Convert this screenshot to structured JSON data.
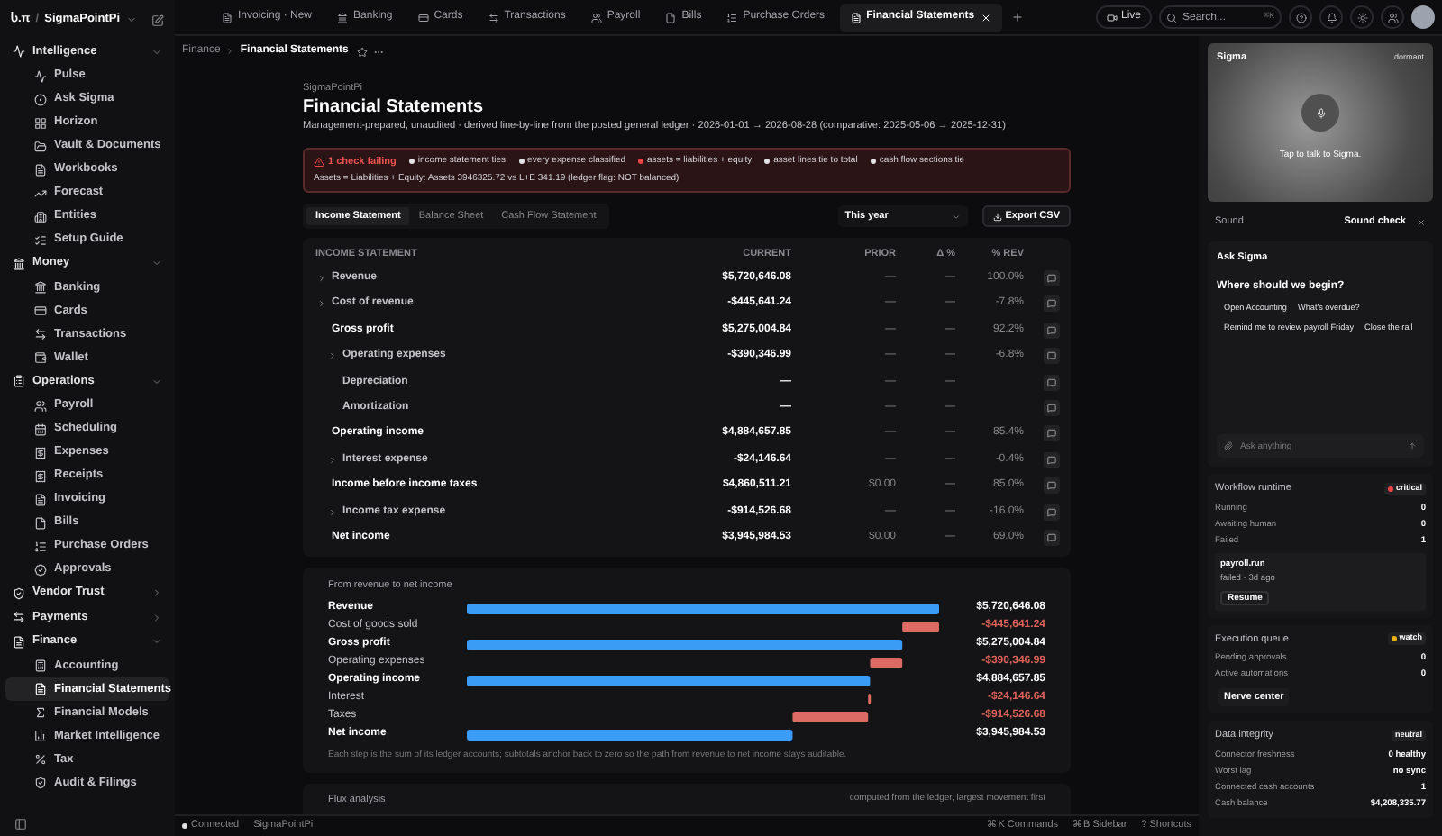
{
  "workspace": {
    "logo": "Ⴑ.π",
    "separator": "/",
    "name": "SigmaPointPi"
  },
  "sidebar": {
    "groups": [
      {
        "label": "Intelligence",
        "expanded": true,
        "items": [
          {
            "label": "Pulse",
            "selected": false
          },
          {
            "label": "Ask Sigma",
            "selected": false
          },
          {
            "label": "Horizon",
            "selected": false
          },
          {
            "label": "Vault & Documents",
            "selected": false
          },
          {
            "label": "Workbooks",
            "selected": false
          },
          {
            "label": "Forecast",
            "selected": false
          },
          {
            "label": "Entities",
            "selected": false
          },
          {
            "label": "Setup Guide",
            "selected": false
          }
        ]
      },
      {
        "label": "Money",
        "expanded": true,
        "items": [
          {
            "label": "Banking",
            "selected": false
          },
          {
            "label": "Cards",
            "selected": false
          },
          {
            "label": "Transactions",
            "selected": false
          },
          {
            "label": "Wallet",
            "selected": false
          }
        ]
      },
      {
        "label": "Operations",
        "expanded": true,
        "items": [
          {
            "label": "Payroll",
            "selected": false
          },
          {
            "label": "Scheduling",
            "selected": false
          },
          {
            "label": "Expenses",
            "selected": false
          },
          {
            "label": "Receipts",
            "selected": false
          },
          {
            "label": "Invoicing",
            "selected": false
          },
          {
            "label": "Bills",
            "selected": false
          },
          {
            "label": "Purchase Orders",
            "selected": false
          },
          {
            "label": "Approvals",
            "selected": false
          }
        ]
      },
      {
        "label": "Vendor Trust",
        "expanded": false
      },
      {
        "label": "Payments",
        "expanded": false
      },
      {
        "label": "Finance",
        "expanded": true,
        "items": [
          {
            "label": "Accounting",
            "selected": false
          },
          {
            "label": "Financial Statements",
            "selected": true
          },
          {
            "label": "Financial Models",
            "selected": false
          },
          {
            "label": "Market Intelligence",
            "selected": false
          },
          {
            "label": "Tax",
            "selected": false
          },
          {
            "label": "Audit & Filings",
            "selected": false
          }
        ]
      }
    ]
  },
  "tabs": [
    {
      "label": "Invoicing · New",
      "selected": false
    },
    {
      "label": "Banking",
      "selected": false
    },
    {
      "label": "Cards",
      "selected": false
    },
    {
      "label": "Transactions",
      "selected": false
    },
    {
      "label": "Payroll",
      "selected": false
    },
    {
      "label": "Bills",
      "selected": false
    },
    {
      "label": "Purchase Orders",
      "selected": false
    },
    {
      "label": "Financial Statements",
      "selected": true
    }
  ],
  "toolbar": {
    "live": "Live",
    "search": {
      "placeholder": "Search...",
      "shortcut": "⌘K"
    }
  },
  "breadcrumb": [
    "Finance",
    "Financial Statements"
  ],
  "header": {
    "company": "SigmaPointPi",
    "title": "Financial Statements",
    "subtitle": "Management-prepared, unaudited · derived line-by-line from the posted general ledger · 2026-01-01 → 2026-08-28 (comparative: 2025-05-06 → 2025-12-31)"
  },
  "checks": {
    "summary": "1 check failing",
    "items": [
      {
        "label": "income statement ties",
        "ok": true
      },
      {
        "label": "every expense classified",
        "ok": true
      },
      {
        "label": "assets = liabilities + equity",
        "ok": false
      },
      {
        "label": "asset lines tie to total",
        "ok": true
      },
      {
        "label": "cash flow sections tie",
        "ok": true
      }
    ],
    "detail": "Assets = Liabilities + Equity: Assets 3946325.72 vs L+E 341.19 (ledger flag: NOT balanced)"
  },
  "statement_tabs": [
    {
      "label": "Income Statement",
      "selected": true
    },
    {
      "label": "Balance Sheet",
      "selected": false
    },
    {
      "label": "Cash Flow Statement",
      "selected": false
    }
  ],
  "period": {
    "value": "This year"
  },
  "export": "Export CSV",
  "table": {
    "columns": [
      "INCOME STATEMENT",
      "CURRENT",
      "PRIOR",
      "Δ %",
      "% REV"
    ],
    "rows": [
      {
        "kind": "account",
        "expanded": false,
        "label": "Revenue",
        "current": "$5,720,646.08",
        "prior": "—",
        "delta": "—",
        "rev": "100.0%"
      },
      {
        "kind": "account",
        "expanded": false,
        "label": "Cost of revenue",
        "current": "-$445,641.24",
        "prior": "—",
        "delta": "—",
        "rev": "-7.8%"
      },
      {
        "kind": "subtotal",
        "label": "Gross profit",
        "current": "$5,275,004.84",
        "prior": "—",
        "delta": "—",
        "rev": "92.2%"
      },
      {
        "kind": "expense",
        "expanded": false,
        "label": "Operating expenses",
        "current": "-$390,346.99",
        "prior": "—",
        "delta": "—",
        "rev": "-6.8%"
      },
      {
        "kind": "detail",
        "label": "Depreciation",
        "current": "—",
        "prior": "—",
        "delta": "—"
      },
      {
        "kind": "detail",
        "label": "Amortization",
        "current": "—",
        "prior": "—",
        "delta": "—"
      },
      {
        "kind": "subtotal",
        "label": "Operating income",
        "current": "$4,884,657.85",
        "prior": "—",
        "delta": "—",
        "rev": "85.4%"
      },
      {
        "kind": "expense",
        "expanded": false,
        "label": "Interest expense",
        "current": "-$24,146.64",
        "prior": "—",
        "delta": "—",
        "rev": "-0.4%"
      },
      {
        "kind": "subtotal",
        "label": "Income before income taxes",
        "current": "$4,860,511.21",
        "prior": "$0.00",
        "delta": "—",
        "rev": "85.0%"
      },
      {
        "kind": "expense",
        "expanded": false,
        "label": "Income tax expense",
        "current": "-$914,526.68",
        "prior": "—",
        "delta": "—",
        "rev": "-16.0%"
      },
      {
        "kind": "subtotal",
        "label": "Net income",
        "current": "$3,945,984.53",
        "prior": "$0.00",
        "delta": "—",
        "rev": "69.0%"
      }
    ]
  },
  "waterfall": {
    "title": "From revenue to net income",
    "steps": [
      {
        "kind": "subtotal",
        "label": "Revenue",
        "value": "$5,720,646.08"
      },
      {
        "kind": "step",
        "label": "Cost of goods sold",
        "value": "-$445,641.24"
      },
      {
        "kind": "subtotal",
        "label": "Gross profit",
        "value": "$5,275,004.84"
      },
      {
        "kind": "step",
        "label": "Operating expenses",
        "value": "-$390,346.99"
      },
      {
        "kind": "subtotal",
        "label": "Operating income",
        "value": "$4,884,657.85"
      },
      {
        "kind": "step",
        "label": "Interest",
        "value": "-$24,146.64"
      },
      {
        "kind": "step",
        "label": "Taxes",
        "value": "-$914,526.68"
      },
      {
        "kind": "subtotal",
        "label": "Net income",
        "value": "$3,945,984.53"
      }
    ],
    "note": "Each step is the sum of its ledger accounts; subtotals anchor back to zero so the path from revenue to net income stays auditable."
  },
  "flux": {
    "title": "Flux analysis",
    "note": "computed from the ledger, largest movement first"
  },
  "status_bar": {
    "connection": "Connected",
    "workspace": "SigmaPointPi",
    "shortcuts": [
      "⌘K Commands",
      "⌘B Sidebar",
      "? Shortcuts"
    ]
  },
  "sigma": {
    "title": "Sigma",
    "status": "dormant",
    "hint": "Tap to talk to Sigma."
  },
  "sound": {
    "label": "Sound",
    "action": "Sound check"
  },
  "ask": {
    "title": "Ask Sigma",
    "prompt": "Where should we begin?",
    "suggestions": [
      "Open Accounting",
      "What's overdue?",
      "Remind me to review payroll Friday",
      "Close the rail"
    ],
    "input": {
      "placeholder": "Ask anything"
    }
  },
  "panels": [
    {
      "title": "Workflow runtime",
      "badge": {
        "label": "critical",
        "color": "#ef4444"
      },
      "stats": [
        {
          "label": "Running",
          "value": "0"
        },
        {
          "label": "Awaiting human",
          "value": "0"
        },
        {
          "label": "Failed",
          "value": "1"
        }
      ],
      "job": {
        "name": "payroll.run",
        "status": "failed · 3d ago",
        "action": "Resume"
      }
    },
    {
      "title": "Execution queue",
      "badge": {
        "label": "watch",
        "color": "#eab308"
      },
      "stats": [
        {
          "label": "Pending approvals",
          "value": "0"
        },
        {
          "label": "Active automations",
          "value": "0"
        }
      ],
      "action": "Nerve center"
    },
    {
      "title": "Data integrity",
      "badge": {
        "label": "neutral"
      },
      "stats": [
        {
          "label": "Connector freshness",
          "value": "0 healthy"
        },
        {
          "label": "Worst lag",
          "value": "no sync"
        },
        {
          "label": "Connected cash accounts",
          "value": "1"
        },
        {
          "label": "Cash balance",
          "value": "$4,208,335.77"
        }
      ]
    }
  ]
}
